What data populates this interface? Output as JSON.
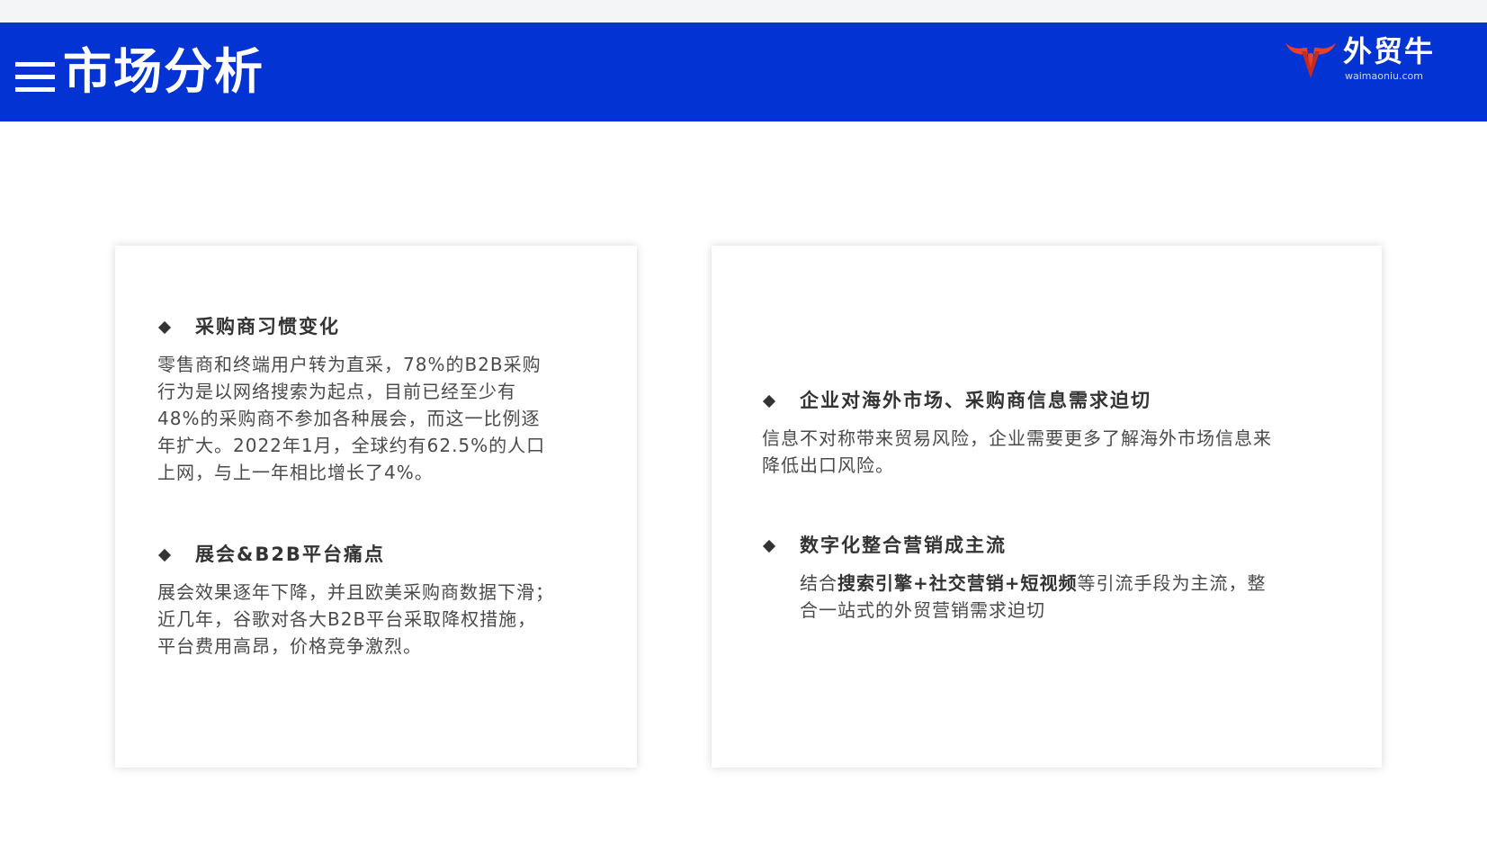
{
  "header": {
    "title": "市场分析",
    "logo_name": "外贸牛",
    "logo_url": "waimaoniu.com"
  },
  "left_card": {
    "sections": [
      {
        "heading": "采购商习惯变化",
        "lines": [
          "零售商和终端用户转为直采，78%的B2B采购",
          "行为是以网络搜索为起点，目前已经至少有",
          "48%的采购商不参加各种展会，而这一比例逐",
          "年扩大。2022年1月，全球约有62.5%的人口",
          "上网，与上一年相比增长了4%。"
        ]
      },
      {
        "heading": "展会&B2B平台痛点",
        "lines": [
          "展会效果逐年下降，并且欧美采购商数据下滑；",
          "近几年，谷歌对各大B2B平台采取降权措施，",
          "平台费用高昂，价格竞争激烈。"
        ]
      }
    ]
  },
  "right_card": {
    "sections": [
      {
        "heading": "企业对海外市场、采购商信息需求迫切",
        "lines": [
          "信息不对称带来贸易风险，企业需要更多了解海外市场信息来",
          "降低出口风险。"
        ]
      },
      {
        "heading": "数字化整合营销成主流",
        "line1": {
          "t1": "结合",
          "b1": "搜索引擎",
          "t2": "+",
          "b2": "社交营销",
          "t3": "+",
          "b3": "短视频",
          "t4": "等引流手段为主流，整"
        },
        "line2": "合一站式的外贸营销需求迫切"
      }
    ]
  },
  "colors": {
    "header_blue": "#0433d4",
    "logo_red": "#e8412c",
    "text": "#333333"
  }
}
